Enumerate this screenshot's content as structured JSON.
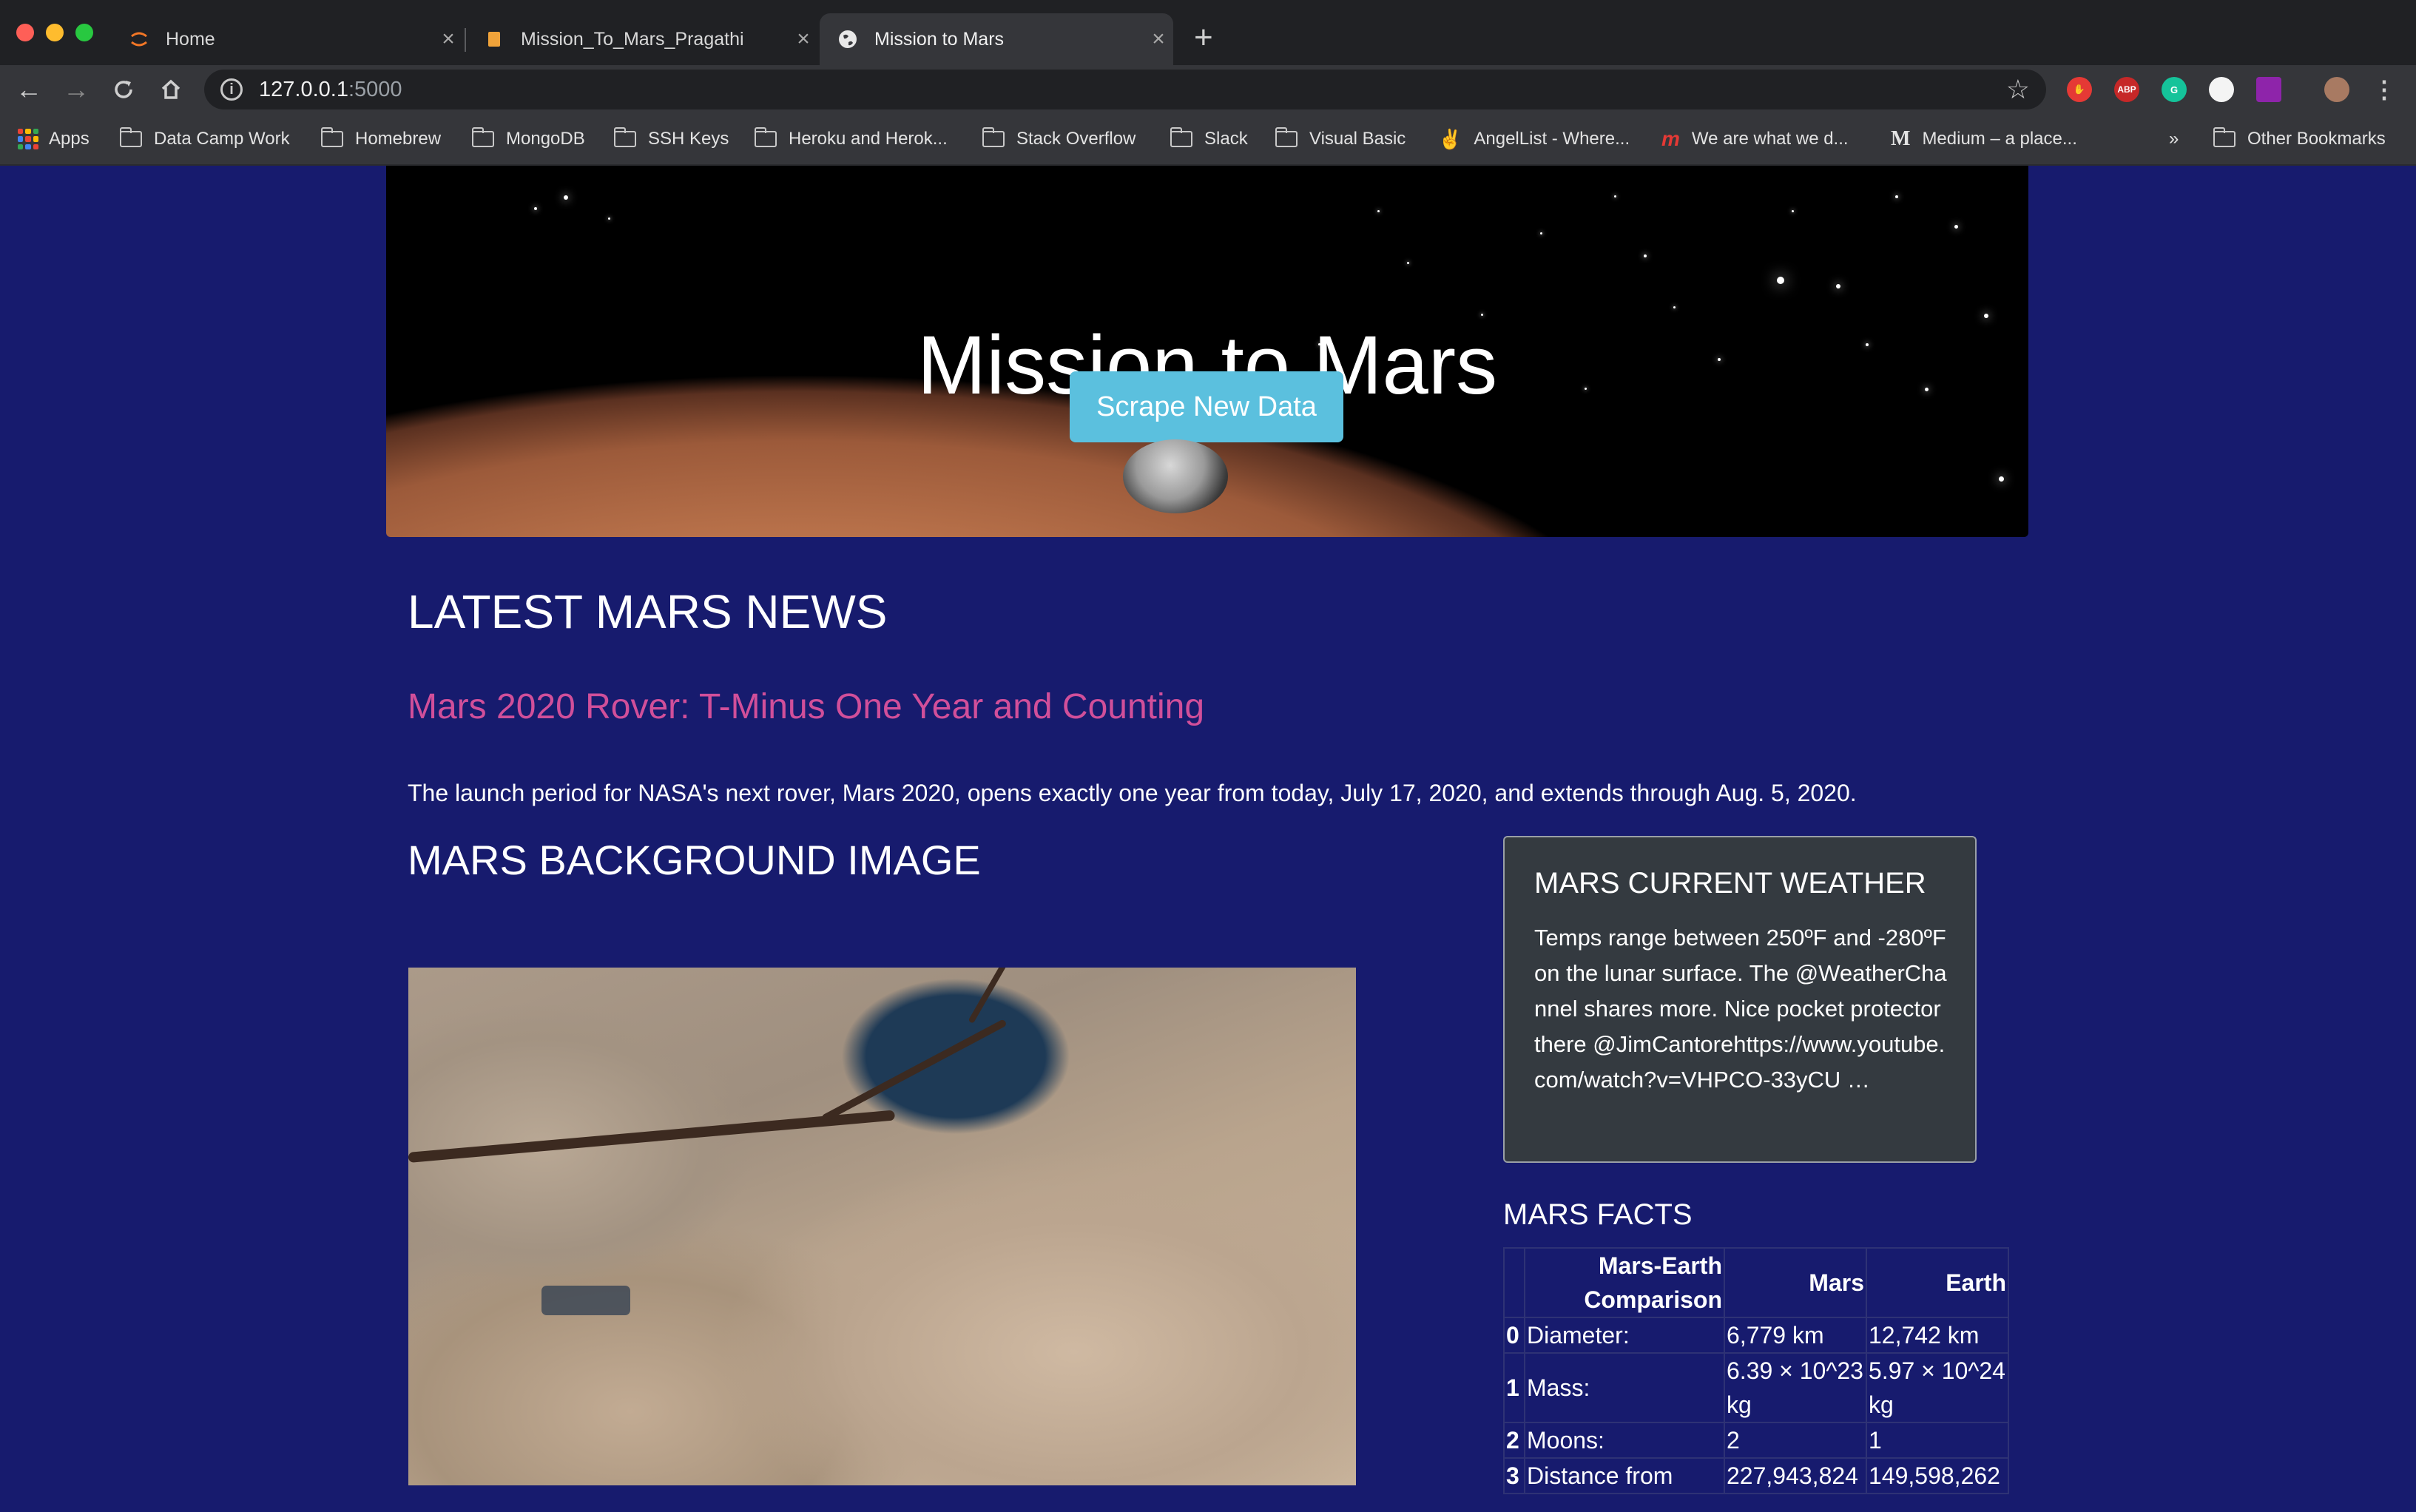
{
  "browser": {
    "tabs": [
      {
        "title": "Home",
        "active": false
      },
      {
        "title": "Mission_To_Mars_Pragathi",
        "active": false
      },
      {
        "title": "Mission to Mars",
        "active": true
      }
    ],
    "url_host": "127.0.0.1",
    "url_port": ":5000",
    "extensions": [
      "ABP"
    ],
    "bookmarks": [
      {
        "label": "Apps",
        "icon": "apps-icon"
      },
      {
        "label": "Data Camp Work",
        "icon": "folder-icon"
      },
      {
        "label": "Homebrew",
        "icon": "folder-icon"
      },
      {
        "label": "MongoDB",
        "icon": "folder-icon"
      },
      {
        "label": "SSH Keys",
        "icon": "folder-icon"
      },
      {
        "label": "Heroku and Herok...",
        "icon": "folder-icon"
      },
      {
        "label": "Stack Overflow",
        "icon": "folder-icon"
      },
      {
        "label": "Slack",
        "icon": "folder-icon"
      },
      {
        "label": "Visual Basic",
        "icon": "folder-icon"
      },
      {
        "label": "AngelList - Where...",
        "icon": "angellist-icon"
      },
      {
        "label": "We are what we d...",
        "icon": "m-logo-icon"
      },
      {
        "label": "Medium – a place...",
        "icon": "medium-icon"
      }
    ],
    "overflow_label": "»",
    "other_bookmarks": "Other Bookmarks"
  },
  "hero": {
    "title": "Mission to Mars",
    "button_label": "Scrape New Data"
  },
  "news": {
    "heading": "LATEST MARS NEWS",
    "title": "Mars 2020 Rover: T-Minus One Year and Counting",
    "paragraph": "The launch period for NASA's next rover, Mars 2020, opens exactly one year from today, July 17, 2020, and extends through Aug. 5, 2020."
  },
  "featured_image": {
    "heading": "MARS BACKGROUND IMAGE"
  },
  "weather": {
    "heading": "MARS CURRENT WEATHER",
    "text": "Temps range between 250ºF and -280ºF on the lunar surface. The @WeatherChannel shares more. Nice pocket protector there @JimCantorehttps://www.youtube.com/watch?v=VHPCO-33yCU …"
  },
  "facts": {
    "heading": "MARS FACTS",
    "columns": [
      "",
      "Mars-Earth Comparison",
      "Mars",
      "Earth"
    ],
    "rows": [
      {
        "index": "0",
        "label": "Diameter:",
        "mars": "6,779 km",
        "earth": "12,742 km"
      },
      {
        "index": "1",
        "label": "Mass:",
        "mars": "6.39 × 10^23 kg",
        "earth": "5.97 × 10^24 kg"
      },
      {
        "index": "2",
        "label": "Moons:",
        "mars": "2",
        "earth": "1"
      },
      {
        "index": "3",
        "label": "Distance from",
        "mars": "227,943,824",
        "earth": "149,598,262"
      }
    ]
  },
  "colors": {
    "page_bg": "#171b6e",
    "news_link": "#d14f9a",
    "button": "#5bc0de",
    "card_bg": "#343a40"
  }
}
